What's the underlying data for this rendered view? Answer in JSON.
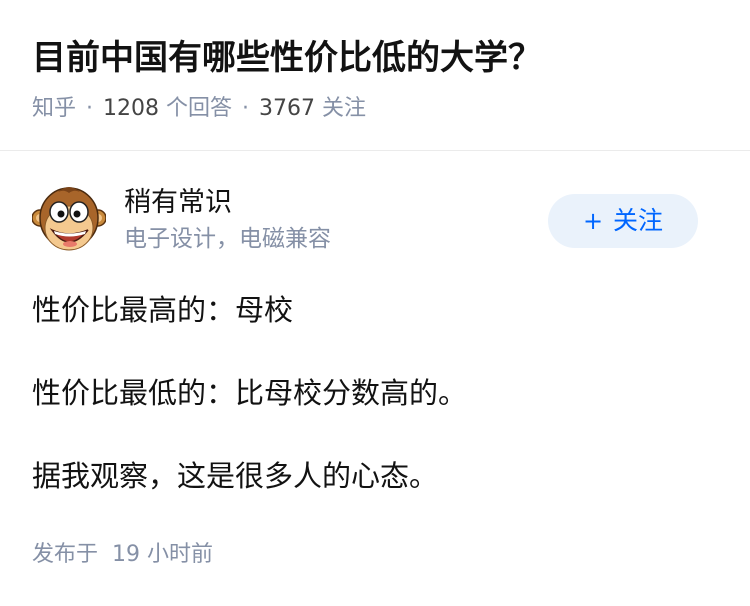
{
  "question": {
    "title": "目前中国有哪些性价比低的大学？",
    "source": "知乎",
    "answer_count": "1208",
    "answer_label": "个回答",
    "follower_count": "3767",
    "follower_label": "关注",
    "separator": "·"
  },
  "author": {
    "name": "稍有常识",
    "headline": "电子设计，电磁兼容",
    "avatar_icon": "cartoon-monkey-avatar"
  },
  "follow_button": {
    "icon": "+",
    "label": "关注",
    "bg_color": "#eaf2fb",
    "text_color": "#0066ff"
  },
  "answer": {
    "paragraphs": [
      "性价比最高的：母校",
      "性价比最低的：比母校分数高的。",
      "据我观察，这是很多人的心态。"
    ],
    "time_label": "发布于",
    "time_value": "19 小时前"
  },
  "colors": {
    "meta_gray": "#8590a6",
    "text_dark": "#121212",
    "divider": "#ebebeb"
  }
}
